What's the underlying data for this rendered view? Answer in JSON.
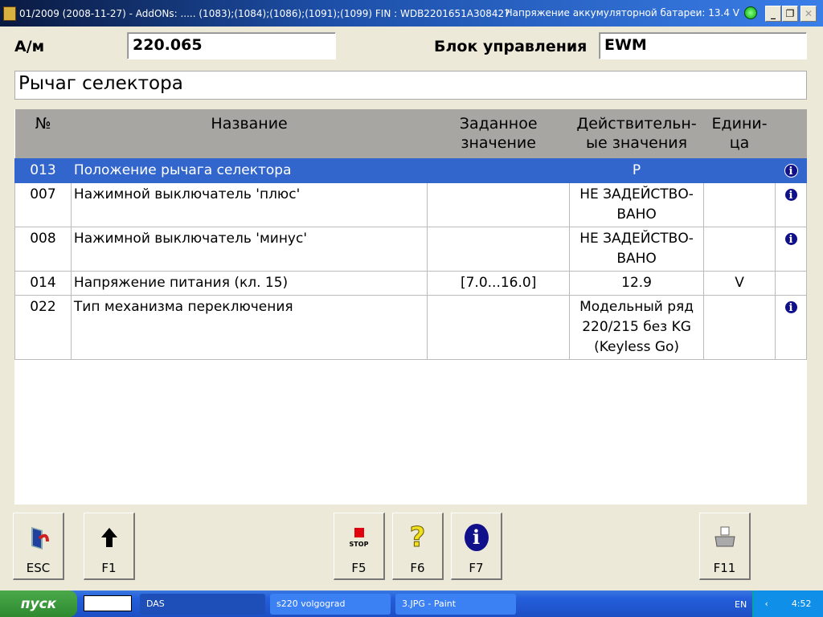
{
  "window": {
    "title": "01/2009 (2008-11-27) - AddONs: ..... (1083);(1084);(1086);(1091);(1099)  FIN : WDB2201651A308427",
    "battery": "Напряжение аккумуляторной батареи: 13.4 V",
    "minimize": "_",
    "restore": "❐",
    "close": "✕"
  },
  "header": {
    "am_label": "А/м",
    "am_value": "220.065",
    "unit_label": "Блок управления",
    "unit_value": "EWM",
    "section_title": "Рычаг селектора"
  },
  "table": {
    "columns": [
      "№",
      "Название",
      "Заданное значение",
      "Действительн-ые значения",
      "Едини-ца"
    ],
    "rows": [
      {
        "no": "013",
        "name": "Положение рычага селектора",
        "target": "",
        "actual": "P",
        "unit": "",
        "info": "i"
      },
      {
        "no": "007",
        "name": "Нажимной выключатель 'плюс'",
        "target": "",
        "actual": "НЕ ЗАДЕЙСТВО-ВАНО",
        "unit": "",
        "info": "i"
      },
      {
        "no": "008",
        "name": "Нажимной выключатель 'минус'",
        "target": "",
        "actual": "НЕ ЗАДЕЙСТВО-ВАНО",
        "unit": "",
        "info": "i"
      },
      {
        "no": "014",
        "name": "Напряжение питания (кл. 15)",
        "target": "[7.0...16.0]",
        "actual": "12.9",
        "unit": "V",
        "info": ""
      },
      {
        "no": "022",
        "name": "Тип механизма переключения",
        "target": "",
        "actual": "Модельный ряд 220/215 без KG (Keyless Go)",
        "unit": "",
        "info": "i"
      }
    ]
  },
  "buttons": {
    "esc": "ESC",
    "f1": "F1",
    "f5": "F5",
    "stop": "STOP",
    "f6": "F6",
    "f7": "F7",
    "f11": "F11"
  },
  "taskbar": {
    "start": "пуск",
    "tasks": [
      "DAS",
      "s220 volgograd",
      "3.JPG - Paint"
    ],
    "lang": "EN",
    "clock": "4:52"
  }
}
